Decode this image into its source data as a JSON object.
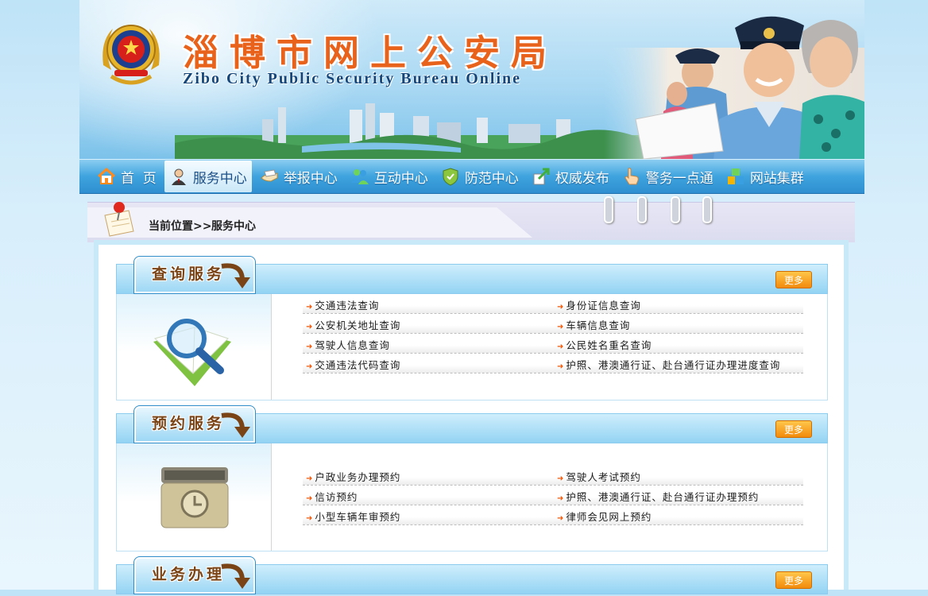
{
  "header": {
    "title_cn": "淄博市网上公安局",
    "title_en": "Zibo City Public Security Bureau Online",
    "emblem_icon": "police-emblem-icon"
  },
  "nav": {
    "items": [
      {
        "label": "首  页",
        "icon": "home-icon"
      },
      {
        "label": "服务中心",
        "icon": "service-person-icon",
        "active": true
      },
      {
        "label": "举报中心",
        "icon": "report-hand-icon"
      },
      {
        "label": "互动中心",
        "icon": "people-icon"
      },
      {
        "label": "防范中心",
        "icon": "shield-icon"
      },
      {
        "label": "权威发布",
        "icon": "publish-icon"
      },
      {
        "label": "警务一点通",
        "icon": "pointer-icon"
      },
      {
        "label": "网站集群",
        "icon": "blocks-icon"
      }
    ]
  },
  "breadcrumb": {
    "label": "当前位置>>",
    "current": "服务中心"
  },
  "sections": [
    {
      "title": "查询服务",
      "more": "更多",
      "icon": "magnifier-book-icon",
      "rows": [
        [
          "交通违法查询",
          "身份证信息查询"
        ],
        [
          "公安机关地址查询",
          "车辆信息查询"
        ],
        [
          "驾驶人信息查询",
          "公民姓名重名查询"
        ],
        [
          "交通违法代码查询",
          "护照、港澳通行证、赴台通行证办理进度查询"
        ]
      ]
    },
    {
      "title": "预约服务",
      "more": "更多",
      "icon": "clock-box-icon",
      "rows": [
        [
          "户政业务办理预约",
          "驾驶人考试预约"
        ],
        [
          "信访预约",
          "护照、港澳通行证、赴台通行证办理预约"
        ],
        [
          "小型车辆年审预约",
          "律师会见网上预约"
        ]
      ]
    },
    {
      "title": "业务办理",
      "more": "更多"
    }
  ],
  "colors": {
    "nav_blue": "#3ea3de",
    "title_orange": "#e8621b",
    "more_orange": "#f28a0c",
    "link_arrow": "#ee5a0b"
  }
}
